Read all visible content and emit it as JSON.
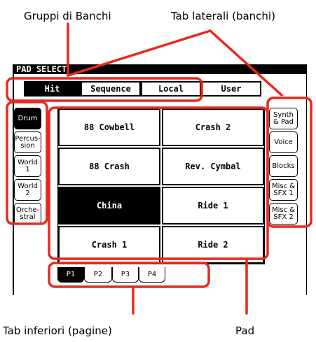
{
  "annotations": {
    "groups": "Gruppi di Banchi",
    "side_tabs": "Tab laterali (banchi)",
    "bottom_tabs": "Tab inferiori (pagine)",
    "pad": "Pad"
  },
  "window": {
    "title": "PAD SELECT"
  },
  "top_tabs": [
    {
      "label": "Hit",
      "selected": true
    },
    {
      "label": "Sequence",
      "selected": false
    },
    {
      "label": "Local",
      "selected": false
    },
    {
      "label": "User",
      "selected": false
    }
  ],
  "left_tabs": [
    {
      "label": "Drum",
      "selected": true
    },
    {
      "label": "Percus-\nsion",
      "selected": false
    },
    {
      "label": "World 1",
      "selected": false
    },
    {
      "label": "World 2",
      "selected": false
    },
    {
      "label": "Orche-\nstral",
      "selected": false
    }
  ],
  "right_tabs": [
    {
      "label": "Synth\n& Pad"
    },
    {
      "label": "Voice"
    },
    {
      "label": "Blocks"
    },
    {
      "label": "Misc &\nSFX 1"
    },
    {
      "label": "Misc &\nSFX 2"
    }
  ],
  "pads": [
    {
      "label": "88 Cowbell",
      "selected": false
    },
    {
      "label": "Crash 2",
      "selected": false
    },
    {
      "label": "88 Crash",
      "selected": false
    },
    {
      "label": "Rev. Cymbal",
      "selected": false
    },
    {
      "label": "China",
      "selected": true
    },
    {
      "label": "Ride 1",
      "selected": false
    },
    {
      "label": "Crash 1",
      "selected": false
    },
    {
      "label": "Ride 2",
      "selected": false
    }
  ],
  "bottom_tabs": [
    {
      "label": "P1",
      "selected": true
    },
    {
      "label": "P2",
      "selected": false
    },
    {
      "label": "P3",
      "selected": false
    },
    {
      "label": "P4",
      "selected": false
    }
  ],
  "colors": {
    "highlight": "#e8281e",
    "selected": "#000000",
    "background": "#ffffff"
  }
}
